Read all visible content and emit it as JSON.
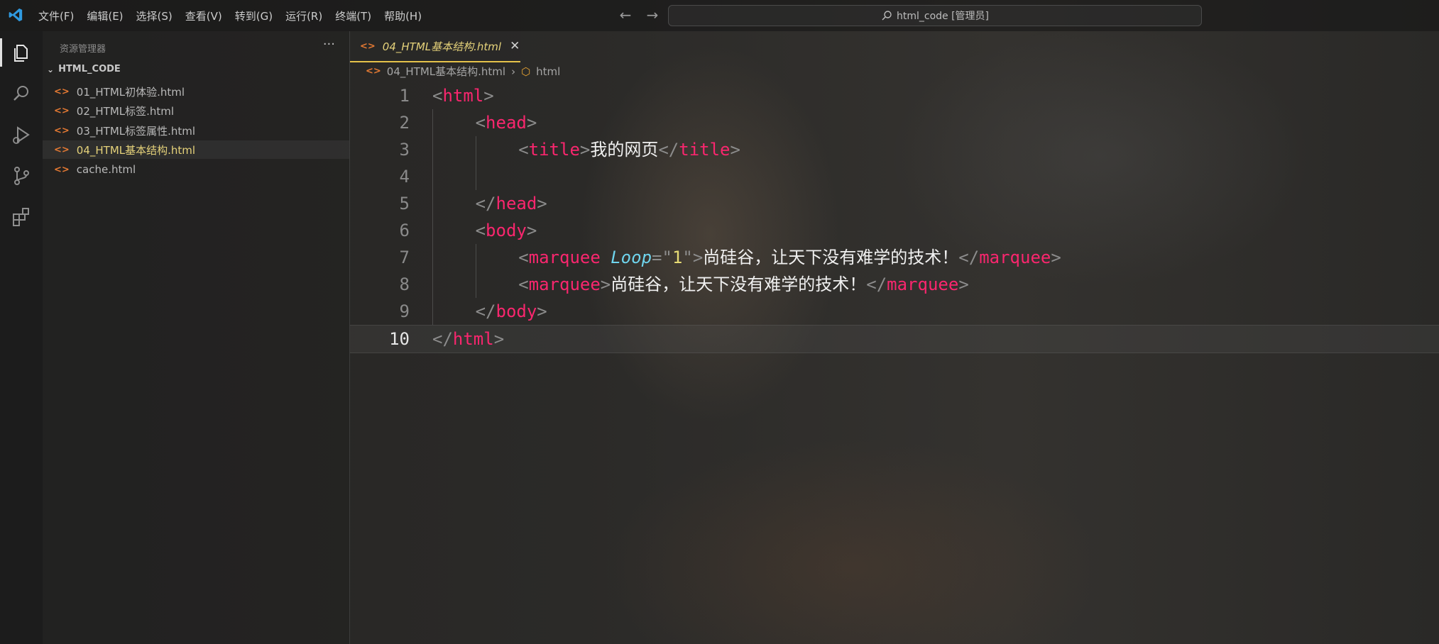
{
  "menu": [
    "文件(F)",
    "编辑(E)",
    "选择(S)",
    "查看(V)",
    "转到(G)",
    "运行(R)",
    "终端(T)",
    "帮助(H)"
  ],
  "command_center": {
    "text": "html_code [管理员]",
    "icon": "search-icon"
  },
  "activity_bar": [
    "explorer-icon",
    "search-icon",
    "run-debug-icon",
    "source-control-icon",
    "extensions-icon"
  ],
  "sidebar": {
    "title": "资源管理器",
    "more": "···",
    "folder": "HTML_CODE",
    "files": [
      {
        "name": "01_HTML初体验.html",
        "active": false
      },
      {
        "name": "02_HTML标签.html",
        "active": false
      },
      {
        "name": "03_HTML标签属性.html",
        "active": false
      },
      {
        "name": "04_HTML基本结构.html",
        "active": true
      },
      {
        "name": "cache.html",
        "active": false
      }
    ]
  },
  "tab": {
    "icon": "<>",
    "label": "04_HTML基本结构.html",
    "close": "✕"
  },
  "breadcrumb": {
    "file": "04_HTML基本结构.html",
    "symbol": "html"
  },
  "editor": {
    "current_line": 10,
    "lines": [
      {
        "n": "1",
        "indent": 0,
        "tokens": [
          [
            "punc",
            "<"
          ],
          [
            "tag",
            "html"
          ],
          [
            "punc",
            ">"
          ]
        ]
      },
      {
        "n": "2",
        "indent": 1,
        "tokens": [
          [
            "punc",
            "<"
          ],
          [
            "tag",
            "head"
          ],
          [
            "punc",
            ">"
          ]
        ]
      },
      {
        "n": "3",
        "indent": 2,
        "tokens": [
          [
            "punc",
            "<"
          ],
          [
            "tag",
            "title"
          ],
          [
            "punc",
            ">"
          ],
          [
            "txt",
            "我的网页"
          ],
          [
            "punc",
            "</"
          ],
          [
            "tag",
            "title"
          ],
          [
            "punc",
            ">"
          ]
        ]
      },
      {
        "n": "4",
        "indent": 2,
        "tokens": []
      },
      {
        "n": "5",
        "indent": 1,
        "tokens": [
          [
            "punc",
            "</"
          ],
          [
            "tag",
            "head"
          ],
          [
            "punc",
            ">"
          ]
        ]
      },
      {
        "n": "6",
        "indent": 1,
        "tokens": [
          [
            "punc",
            "<"
          ],
          [
            "tag",
            "body"
          ],
          [
            "punc",
            ">"
          ]
        ]
      },
      {
        "n": "7",
        "indent": 2,
        "tokens": [
          [
            "punc",
            "<"
          ],
          [
            "tag",
            "marquee "
          ],
          [
            "attr",
            "Loop"
          ],
          [
            "punc",
            "=\""
          ],
          [
            "str",
            "1"
          ],
          [
            "punc",
            "\">"
          ],
          [
            "txt",
            "尚硅谷，让天下没有难学的技术！"
          ],
          [
            "punc",
            "</"
          ],
          [
            "tag",
            "marquee"
          ],
          [
            "punc",
            ">"
          ]
        ]
      },
      {
        "n": "8",
        "indent": 2,
        "tokens": [
          [
            "punc",
            "<"
          ],
          [
            "tag",
            "marquee"
          ],
          [
            "punc",
            ">"
          ],
          [
            "txt",
            "尚硅谷，让天下没有难学的技术！"
          ],
          [
            "punc",
            "</"
          ],
          [
            "tag",
            "marquee"
          ],
          [
            "punc",
            ">"
          ]
        ]
      },
      {
        "n": "9",
        "indent": 1,
        "tokens": [
          [
            "punc",
            "</"
          ],
          [
            "tag",
            "body"
          ],
          [
            "punc",
            ">"
          ]
        ]
      },
      {
        "n": "10",
        "indent": 0,
        "tokens": [
          [
            "punc",
            "</"
          ],
          [
            "tag",
            "html"
          ],
          [
            "punc",
            ">"
          ]
        ]
      }
    ]
  },
  "colors": {
    "tag": "#f9266e",
    "attr": "#6fd5ee",
    "string": "#e6db74",
    "punctuation": "#8c8c8c",
    "active_file": "#e5d27a",
    "file_icon": "#e37933"
  }
}
